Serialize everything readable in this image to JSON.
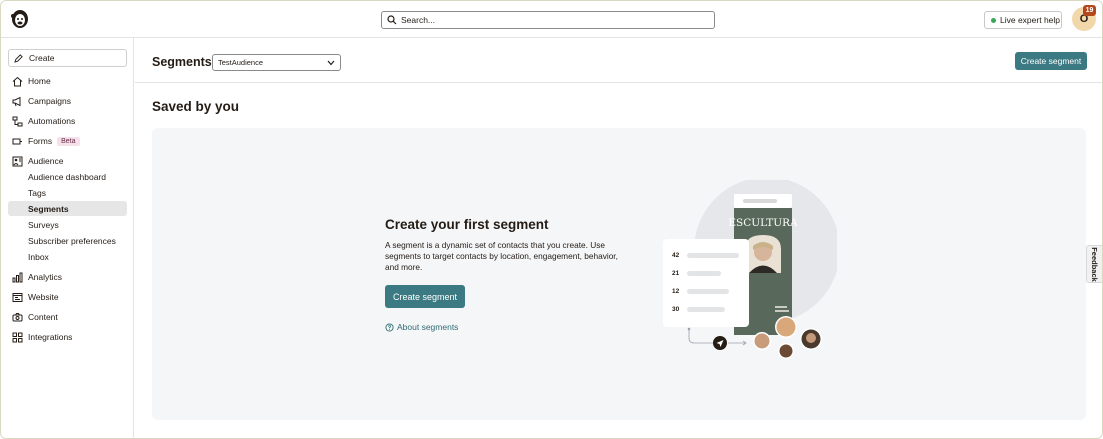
{
  "topbar": {
    "search_placeholder": "Search...",
    "expert_help_label": "Live expert help",
    "avatar_initial": "O",
    "notification_count": "19"
  },
  "sidebar": {
    "create_label": "Create",
    "items": [
      {
        "label": "Home",
        "icon": "home-icon"
      },
      {
        "label": "Campaigns",
        "icon": "megaphone-icon"
      },
      {
        "label": "Automations",
        "icon": "automation-icon"
      },
      {
        "label": "Forms",
        "icon": "forms-icon",
        "badge": "Beta"
      },
      {
        "label": "Audience",
        "icon": "audience-icon"
      }
    ],
    "audience_sub": [
      {
        "label": "Audience dashboard"
      },
      {
        "label": "Tags"
      },
      {
        "label": "Segments",
        "active": true
      },
      {
        "label": "Surveys"
      },
      {
        "label": "Subscriber preferences"
      },
      {
        "label": "Inbox"
      }
    ],
    "bottom_items": [
      {
        "label": "Analytics",
        "icon": "analytics-icon"
      },
      {
        "label": "Website",
        "icon": "website-icon"
      },
      {
        "label": "Content",
        "icon": "content-icon"
      },
      {
        "label": "Integrations",
        "icon": "integrations-icon"
      }
    ]
  },
  "header": {
    "title": "Segments",
    "audience_selected": "TestAudience",
    "create_segment_label": "Create segment"
  },
  "main": {
    "saved_title": "Saved by you",
    "empty_title": "Create your first segment",
    "empty_description": "A segment is a dynamic set of contacts that you create. Use segments to target contacts by location, engagement, behavior, and more.",
    "create_button_label": "Create segment",
    "about_link_label": "About segments"
  },
  "illustration": {
    "card_title": "ESCULTURA",
    "list_numbers": [
      "42",
      "21",
      "12",
      "30"
    ]
  },
  "feedback_label": "Feedback",
  "colors": {
    "primary": "#3b7a82",
    "panel_bg": "#f5f6f8",
    "badge": "#b4471c"
  }
}
